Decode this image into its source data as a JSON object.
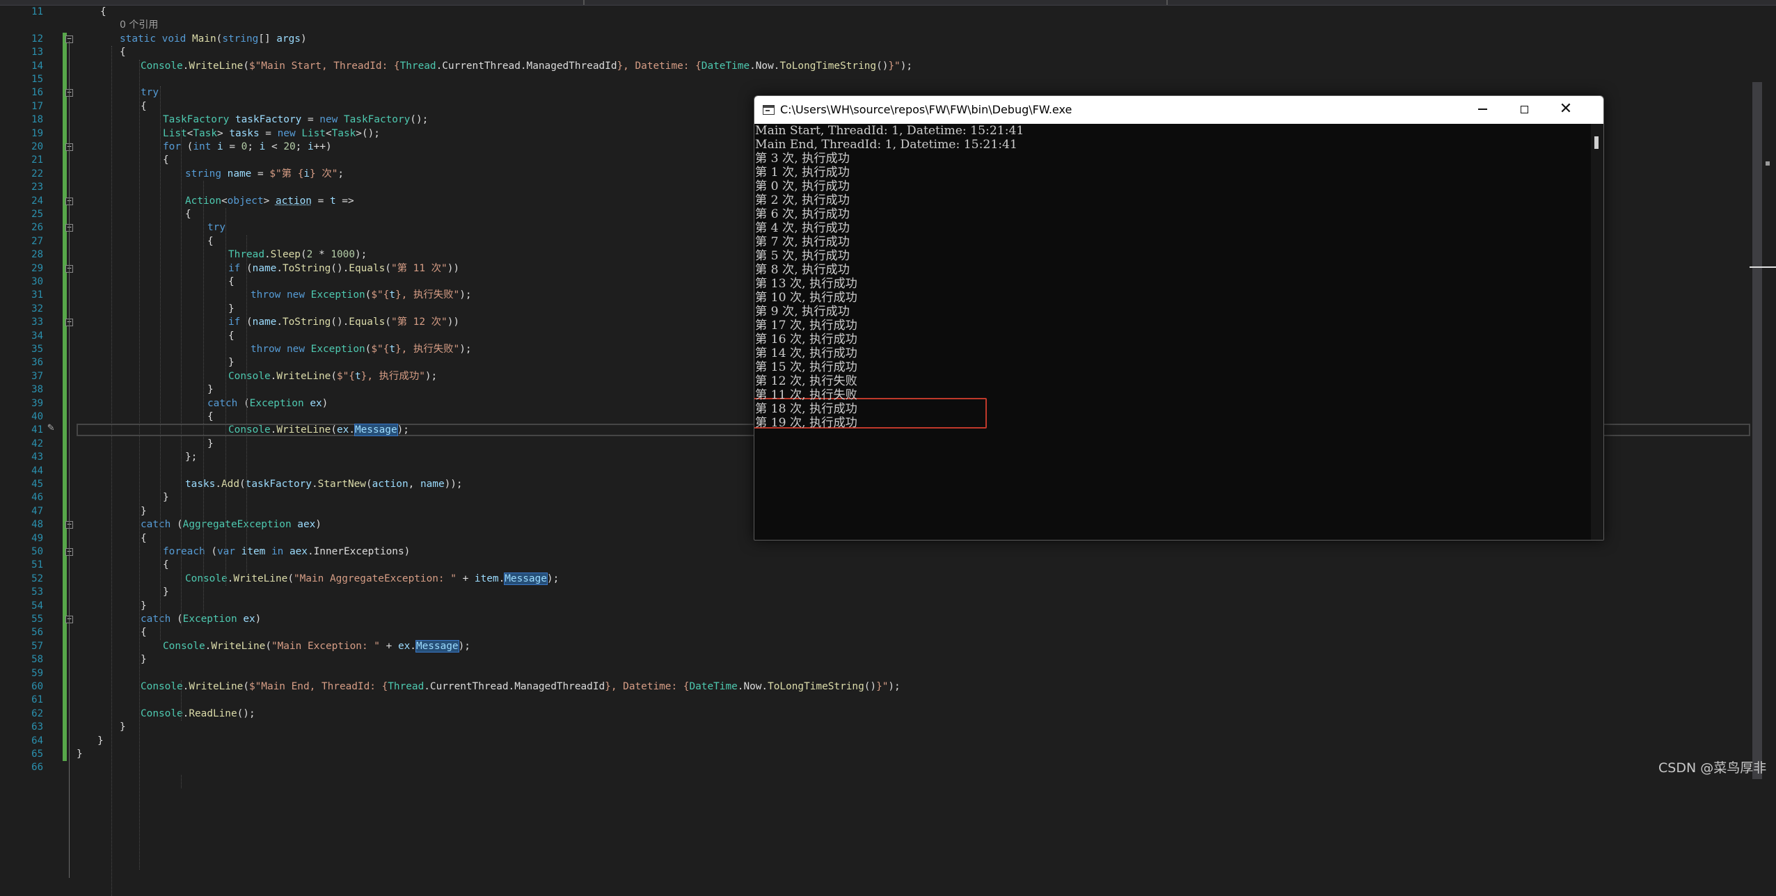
{
  "editor": {
    "references_label": "0 个引用",
    "lines": [
      {
        "n": "11",
        "html": "<span class='ind' style='margin-left:34px'>{</span>"
      },
      {
        "n": "",
        "html": ""
      },
      {
        "n": "12",
        "html": "<span style='margin-left:62px'><span class='kw'>static</span> <span class='kw'>void</span> <span class='fn'>Main</span>(<span class='kw'>string</span>[] <span class='va'>args</span>)</span>"
      },
      {
        "n": "13",
        "html": "<span style='margin-left:62px'>{</span>"
      },
      {
        "n": "14",
        "html": "<span style='margin-left:92px'><span class='ty'>Console</span>.<span class='fn'>WriteLine</span>(<span class='st'>$\"Main Start, ThreadId: {</span><span class='ty'>Thread</span>.CurrentThread.ManagedThreadId<span class='st'>}, Datetime: {</span><span class='ty'>DateTime</span>.Now.<span class='fn'>ToLongTimeString</span>()<span class='st'>}\"</span>);</span>"
      },
      {
        "n": "15",
        "html": ""
      },
      {
        "n": "16",
        "html": "<span style='margin-left:92px'><span class='kw'>try</span></span>"
      },
      {
        "n": "17",
        "html": "<span style='margin-left:92px'>{</span>"
      },
      {
        "n": "18",
        "html": "<span style='margin-left:124px'><span class='ty'>TaskFactory</span> <span class='va'>taskFactory</span> = <span class='kw'>new</span> <span class='ty'>TaskFactory</span>();</span>"
      },
      {
        "n": "19",
        "html": "<span style='margin-left:124px'><span class='ty'>List</span>&lt;<span class='ty'>Task</span>&gt; <span class='va'>tasks</span> = <span class='kw'>new</span> <span class='ty'>List</span>&lt;<span class='ty'>Task</span>&gt;();</span>"
      },
      {
        "n": "20",
        "html": "<span style='margin-left:124px'><span class='kw'>for</span> (<span class='kw'>int</span> <span class='va'>i</span> = <span class='nu'>0</span>; <span class='va'>i</span> &lt; <span class='nu'>20</span>; <span class='va'>i</span>++)</span>"
      },
      {
        "n": "21",
        "html": "<span style='margin-left:124px'>{</span>"
      },
      {
        "n": "22",
        "html": "<span style='margin-left:156px'><span class='kw'>string</span> <span class='va'>name</span> = <span class='st'>$\"第 {</span><span class='va'>i</span><span class='st'>} 次\"</span>;</span>"
      },
      {
        "n": "23",
        "html": ""
      },
      {
        "n": "24",
        "html": "<span style='margin-left:156px'><span class='ty'>Action</span>&lt;<span class='kw'>object</span>&gt; <span class='va und'>action</span> = <span class='va'>t</span> =&gt;</span>"
      },
      {
        "n": "25",
        "html": "<span style='margin-left:156px'>{</span>"
      },
      {
        "n": "26",
        "html": "<span style='margin-left:188px'><span class='kw'>try</span></span>"
      },
      {
        "n": "27",
        "html": "<span style='margin-left:188px'>{</span>"
      },
      {
        "n": "28",
        "html": "<span style='margin-left:218px'><span class='ty'>Thread</span>.<span class='fn'>Sleep</span>(<span class='nu'>2</span> * <span class='nu'>1000</span>);</span>"
      },
      {
        "n": "29",
        "html": "<span style='margin-left:218px'><span class='kw'>if</span> (<span class='va'>name</span>.<span class='fn'>ToString</span>().<span class='fn'>Equals</span>(<span class='st'>\"第 11 次\"</span>))</span>"
      },
      {
        "n": "30",
        "html": "<span style='margin-left:218px'>{</span>"
      },
      {
        "n": "31",
        "html": "<span style='margin-left:250px'><span class='kw'>throw</span> <span class='kw'>new</span> <span class='ty'>Exception</span>(<span class='st'>$\"{</span><span class='va'>t</span><span class='st'>}, 执行失败\"</span>);</span>"
      },
      {
        "n": "32",
        "html": "<span style='margin-left:218px'>}</span>"
      },
      {
        "n": "33",
        "html": "<span style='margin-left:218px'><span class='kw'>if</span> (<span class='va'>name</span>.<span class='fn'>ToString</span>().<span class='fn'>Equals</span>(<span class='st'>\"第 12 次\"</span>))</span>"
      },
      {
        "n": "34",
        "html": "<span style='margin-left:218px'>{</span>"
      },
      {
        "n": "35",
        "html": "<span style='margin-left:250px'><span class='kw'>throw</span> <span class='kw'>new</span> <span class='ty'>Exception</span>(<span class='st'>$\"{</span><span class='va'>t</span><span class='st'>}, 执行失败\"</span>);</span>"
      },
      {
        "n": "36",
        "html": "<span style='margin-left:218px'>}</span>"
      },
      {
        "n": "37",
        "html": "<span style='margin-left:218px'><span class='ty'>Console</span>.<span class='fn'>WriteLine</span>(<span class='st'>$\"{</span><span class='va'>t</span><span class='st'>}, 执行成功\"</span>);</span>"
      },
      {
        "n": "38",
        "html": "<span style='margin-left:188px'>}</span>"
      },
      {
        "n": "39",
        "html": "<span style='margin-left:188px'><span class='kw'>catch</span> (<span class='ty'>Exception</span> <span class='va'>ex</span>)</span>"
      },
      {
        "n": "40",
        "html": "<span style='margin-left:188px'>{</span>"
      },
      {
        "n": "41",
        "html": "<span style='margin-left:218px'><span class='ty'>Console</span>.<span class='fn'>WriteLine</span>(<span class='va'>ex</span>.<span class='hl va'>Message</span>);</span>"
      },
      {
        "n": "42",
        "html": "<span style='margin-left:188px'>}</span>"
      },
      {
        "n": "43",
        "html": "<span style='margin-left:156px'>};</span>"
      },
      {
        "n": "44",
        "html": ""
      },
      {
        "n": "45",
        "html": "<span style='margin-left:156px'><span class='va'>tasks</span>.<span class='fn'>Add</span>(<span class='va'>taskFactory</span>.<span class='fn'>StartNew</span>(<span class='va'>action</span>, <span class='va'>name</span>));</span>"
      },
      {
        "n": "46",
        "html": "<span style='margin-left:124px'>}</span>"
      },
      {
        "n": "47",
        "html": "<span style='margin-left:92px'>}</span>"
      },
      {
        "n": "48",
        "html": "<span style='margin-left:92px'><span class='kw'>catch</span> (<span class='ty'>AggregateException</span> <span class='va'>aex</span>)</span>"
      },
      {
        "n": "49",
        "html": "<span style='margin-left:92px'>{</span>"
      },
      {
        "n": "50",
        "html": "<span style='margin-left:124px'><span class='kw'>foreach</span> (<span class='kw'>var</span> <span class='va'>item</span> <span class='kw'>in</span> <span class='va'>aex</span>.InnerExceptions)</span>"
      },
      {
        "n": "51",
        "html": "<span style='margin-left:124px'>{</span>"
      },
      {
        "n": "52",
        "html": "<span style='margin-left:156px'><span class='ty'>Console</span>.<span class='fn'>WriteLine</span>(<span class='st'>\"Main AggregateException: \"</span> + <span class='va'>item</span>.<span class='hl va'>Message</span>);</span>"
      },
      {
        "n": "53",
        "html": "<span style='margin-left:124px'>}</span>"
      },
      {
        "n": "54",
        "html": "<span style='margin-left:92px'>}</span>"
      },
      {
        "n": "55",
        "html": "<span style='margin-left:92px'><span class='kw'>catch</span> (<span class='ty'>Exception</span> <span class='va'>ex</span>)</span>"
      },
      {
        "n": "56",
        "html": "<span style='margin-left:92px'>{</span>"
      },
      {
        "n": "57",
        "html": "<span style='margin-left:124px'><span class='ty'>Console</span>.<span class='fn'>WriteLine</span>(<span class='st'>\"Main Exception: \"</span> + <span class='va'>ex</span>.<span class='hl va'>Message</span>);</span>"
      },
      {
        "n": "58",
        "html": "<span style='margin-left:92px'>}</span>"
      },
      {
        "n": "59",
        "html": ""
      },
      {
        "n": "60",
        "html": "<span style='margin-left:92px'><span class='ty'>Console</span>.<span class='fn'>WriteLine</span>(<span class='st'>$\"Main End, ThreadId: {</span><span class='ty'>Thread</span>.CurrentThread.ManagedThreadId<span class='st'>}, Datetime: {</span><span class='ty'>DateTime</span>.Now.<span class='fn'>ToLongTimeString</span>()<span class='st'>}\"</span>);</span>"
      },
      {
        "n": "61",
        "html": ""
      },
      {
        "n": "62",
        "html": "<span style='margin-left:92px'><span class='ty'>Console</span>.<span class='fn'>ReadLine</span>();</span>"
      },
      {
        "n": "63",
        "html": "<span style='margin-left:62px'>}</span>"
      },
      {
        "n": "64",
        "html": "<span style='margin-left:30px'>}</span>"
      },
      {
        "n": "65",
        "html": "<span style='margin-left:0px'>}</span>"
      },
      {
        "n": "66",
        "html": ""
      }
    ]
  },
  "console": {
    "title": "C:\\Users\\WH\\source\\repos\\FW\\FW\\bin\\Debug\\FW.exe",
    "minimize_label": "—",
    "close_label": "✕",
    "output": [
      "Main Start, ThreadId: 1, Datetime: 15:21:41",
      "Main End, ThreadId: 1, Datetime: 15:21:41",
      "第 3 次, 执行成功",
      "第 1 次, 执行成功",
      "第 0 次, 执行成功",
      "第 2 次, 执行成功",
      "第 6 次, 执行成功",
      "第 4 次, 执行成功",
      "第 7 次, 执行成功",
      "第 5 次, 执行成功",
      "第 8 次, 执行成功",
      "第 13 次, 执行成功",
      "第 10 次, 执行成功",
      "第 9 次, 执行成功",
      "第 17 次, 执行成功",
      "第 16 次, 执行成功",
      "第 14 次, 执行成功",
      "第 15 次, 执行成功",
      "第 12 次, 执行失败",
      "第 11 次, 执行失败",
      "第 18 次, 执行成功",
      "第 19 次, 执行成功"
    ]
  },
  "watermark": "CSDN @菜鸟厚非",
  "colors": {
    "editor_bg": "#1e1e1e",
    "line_number": "#2b91af",
    "keyword": "#569cd6",
    "type": "#4ec9b0",
    "string": "#d69d85",
    "console_bg": "#0c0c0c",
    "highlight_box": "#c0392b"
  }
}
